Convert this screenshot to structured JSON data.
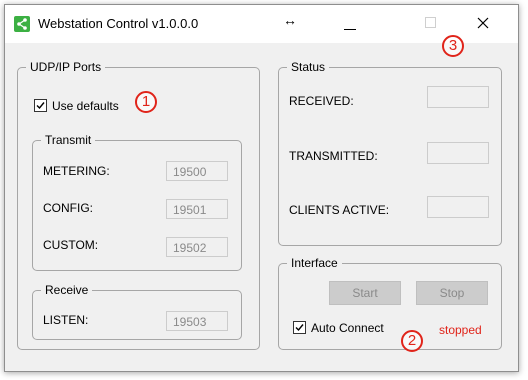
{
  "window": {
    "title": "Webstation Control v1.0.0.0",
    "resize_glyph": "↔",
    "close_glyph": "✕"
  },
  "callouts": [
    "1",
    "2",
    "3"
  ],
  "udp_ports": {
    "title": "UDP/IP Ports",
    "use_defaults_label": "Use defaults",
    "use_defaults_checked": true,
    "transmit": {
      "title": "Transmit",
      "rows": [
        {
          "label": "METERING:",
          "value": "19500"
        },
        {
          "label": "CONFIG:",
          "value": "19501"
        },
        {
          "label": "CUSTOM:",
          "value": "19502"
        }
      ]
    },
    "receive": {
      "title": "Receive",
      "rows": [
        {
          "label": "LISTEN:",
          "value": "19503"
        }
      ]
    }
  },
  "status": {
    "title": "Status",
    "rows": [
      {
        "label": "RECEIVED:",
        "value": ""
      },
      {
        "label": "TRANSMITTED:",
        "value": ""
      },
      {
        "label": "CLIENTS ACTIVE:",
        "value": ""
      }
    ]
  },
  "interface": {
    "title": "Interface",
    "start_label": "Start",
    "stop_label": "Stop",
    "auto_connect_label": "Auto Connect",
    "auto_connect_checked": true,
    "connection_status": "stopped"
  },
  "colors": {
    "accent_red": "#e0241a",
    "app_icon_green": "#3cb043"
  },
  "icons": {
    "app": "share-icon",
    "minimize": "minimize-icon",
    "maximize": "maximize-icon",
    "close": "close-icon"
  }
}
